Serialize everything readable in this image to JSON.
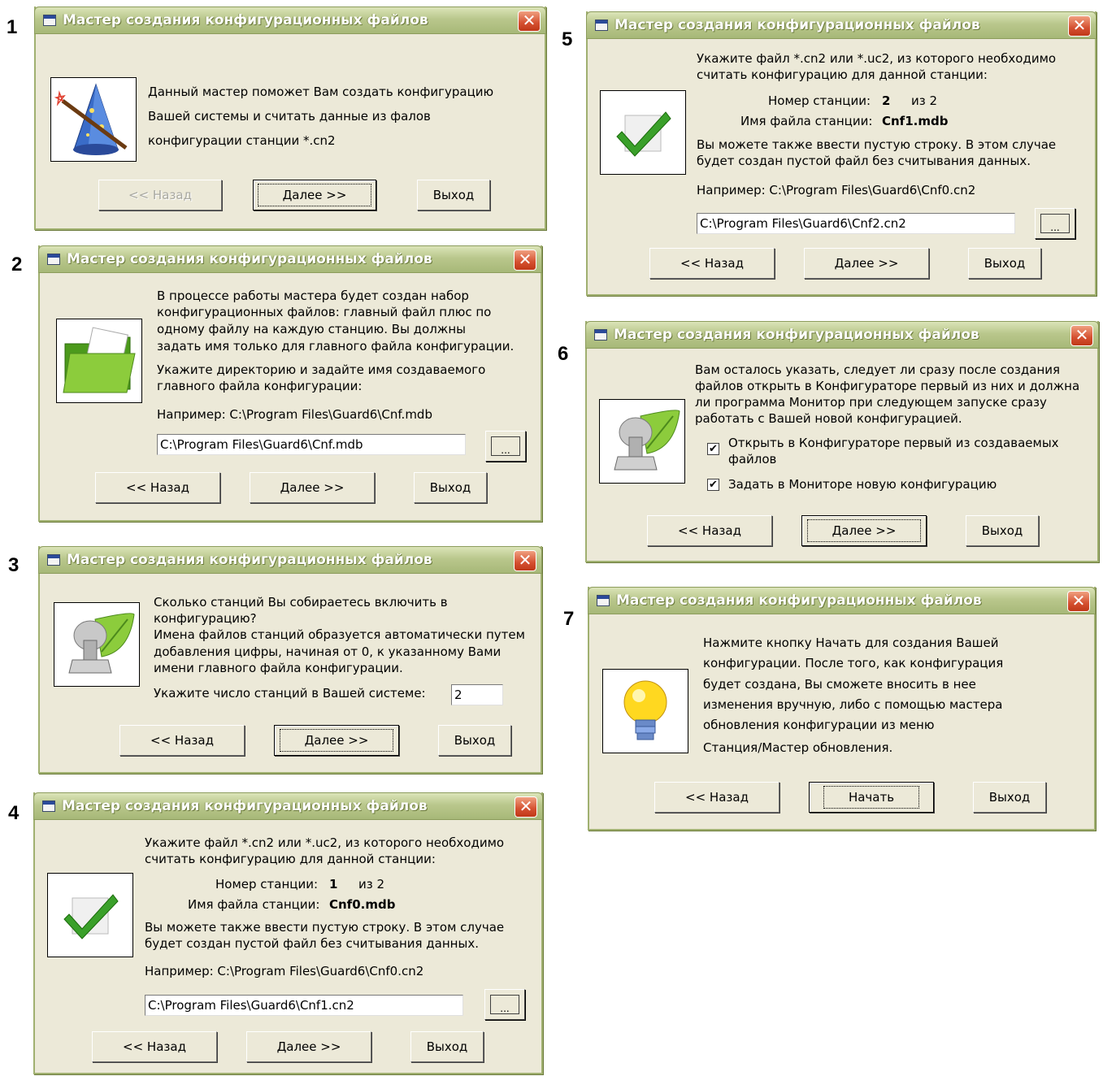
{
  "title": "Мастер создания конфигурационных файлов",
  "close_glyph": "✕",
  "buttons": {
    "back": "<< Назад",
    "next": "Далее >>",
    "exit": "Выход",
    "start": "Начать",
    "browse": "..."
  },
  "steps": {
    "s1": {
      "num": "1",
      "lines": [
        "Данный мастер поможет Вам создать конфигурацию",
        "Вашей системы и считать данные из фалов",
        "конфигурации станции *.cn2"
      ]
    },
    "s2": {
      "num": "2",
      "lines": [
        "В процессе работы мастера будет создан набор",
        "конфигурационных файлов: главный файл плюс по",
        "одному  файлу на каждую станцию. Вы должны",
        "задать имя только для главного файла конфигурации."
      ],
      "lines2": [
        "Укажите директорию и задайте имя создаваемого",
        "главного  файла конфигурации:"
      ],
      "example": "Например:   C:\\Program Files\\Guard6\\Cnf.mdb",
      "input_value": "C:\\Program Files\\Guard6\\Cnf.mdb"
    },
    "s3": {
      "num": "3",
      "lines": [
        "Сколько станций Вы собираетесь включить в",
        "конфигурацию?",
        "Имена файлов станций образуется автоматически путем",
        "добавления цифры, начиная от 0, к указанному Вами",
        "имени  главного файла конфигурации."
      ],
      "count_label": "Укажите число станций в Вашей системе:",
      "count_value": "2"
    },
    "s4": {
      "num": "4",
      "lines": [
        "Укажите файл *.cn2 или *.uc2, из которого необходимо",
        "считать конфигурацию для данной станции:"
      ],
      "station_label": "Номер станции:",
      "station_num": "1",
      "station_of": "из 2",
      "file_label": "Имя файла станции:",
      "file_name": "Cnf0.mdb",
      "lines2": [
        "Вы можете также ввести пустую строку. В этом случае",
        "будет создан пустой файл без считывания данных."
      ],
      "example": "Например:   C:\\Program Files\\Guard6\\Cnf0.cn2",
      "input_value": "C:\\Program Files\\Guard6\\Cnf1.cn2"
    },
    "s5": {
      "num": "5",
      "lines": [
        "Укажите файл *.cn2 или *.uc2, из которого необходимо",
        "считать конфигурацию для данной станции:"
      ],
      "station_label": "Номер станции:",
      "station_num": "2",
      "station_of": "из 2",
      "file_label": "Имя файла станции:",
      "file_name": "Cnf1.mdb",
      "lines2": [
        "Вы можете также ввести пустую строку. В этом случае",
        "будет создан пустой файл без считывания данных."
      ],
      "example": "Например:   C:\\Program Files\\Guard6\\Cnf0.cn2",
      "input_value": "C:\\Program Files\\Guard6\\Cnf2.cn2"
    },
    "s6": {
      "num": "6",
      "lines": [
        "Вам осталось указать, следует ли сразу после создания",
        "файлов открыть в Конфигураторе первый из них и должна",
        "ли программа Монитор при следующем запуске сразу",
        "работать с Вашей новой конфигурацией."
      ],
      "check1_lines": [
        "Открыть в Конфигураторе первый из создаваемых",
        "файлов"
      ],
      "check2": "Задать в Мониторе новую конфигурацию",
      "check_mark": "✔"
    },
    "s7": {
      "num": "7",
      "lines": [
        "Нажмите кнопку Начать для создания Вашей",
        "конфигурации. После того, как конфигурация",
        "будет создана, Вы сможете вносить в нее",
        "изменения вручную, либо с помощью мастера",
        "обновления конфигурации из меню",
        "Станция/Мастер обновления."
      ]
    }
  }
}
